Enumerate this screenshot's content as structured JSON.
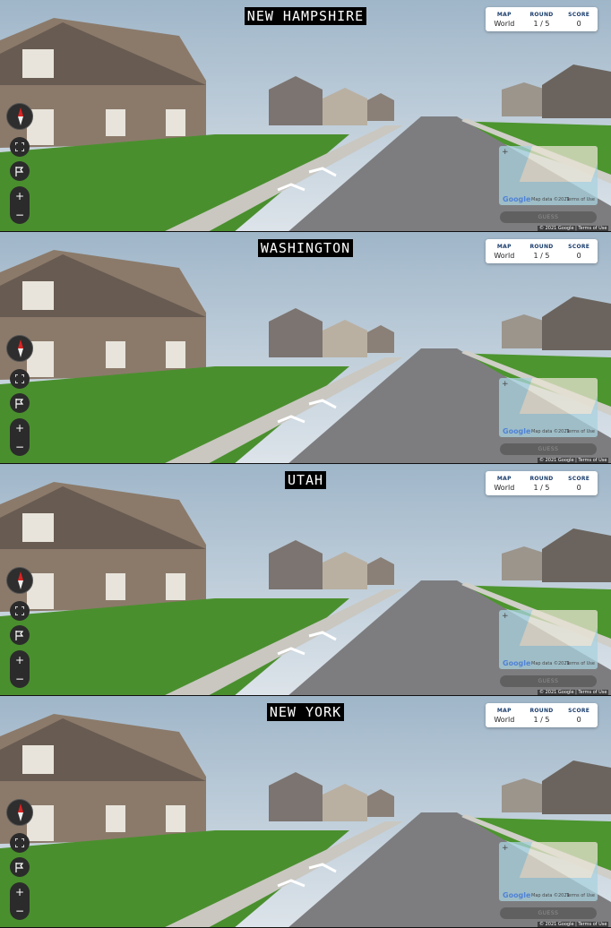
{
  "panels": [
    {
      "location": "NEW HAMPSHIRE",
      "map": "World",
      "round": "1 / 5",
      "score": "0"
    },
    {
      "location": "WASHINGTON",
      "map": "World",
      "round": "1 / 5",
      "score": "0"
    },
    {
      "location": "UTAH",
      "map": "World",
      "round": "1 / 5",
      "score": "0"
    },
    {
      "location": "NEW YORK",
      "map": "World",
      "round": "1 / 5",
      "score": "0"
    }
  ],
  "labels": {
    "map": "MAP",
    "round": "ROUND",
    "score": "SCORE",
    "guess": "GUESS",
    "minimap_brand": "Google",
    "map_data": "Map data ©2021",
    "terms": "Terms of Use",
    "copyright": "© 2021 Google  |  Terms of Use",
    "zoom_in": "+",
    "zoom_out": "−",
    "minimap_zoom": "+"
  },
  "icons": {
    "compass": "compass-icon",
    "fullscreen": "fullscreen-icon",
    "flag": "flag-icon"
  },
  "colors": {
    "sky": "#b8c6d4",
    "grass": "#3f8a2c",
    "road": "#7a7a7a",
    "caption_bg": "#000000",
    "stat_label": "#1a3d6d"
  }
}
